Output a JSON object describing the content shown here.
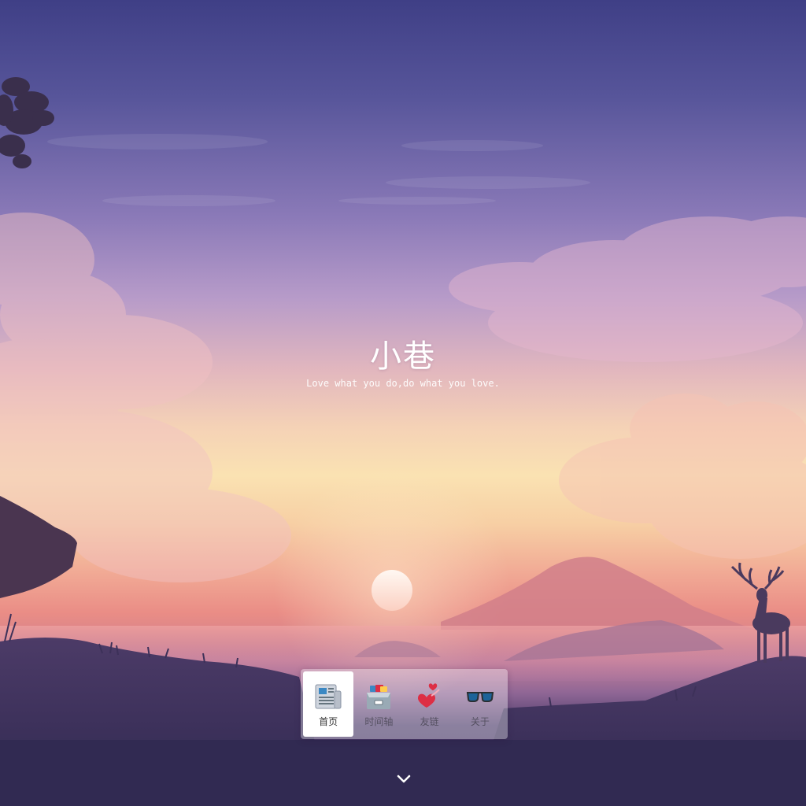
{
  "hero": {
    "title": "小巷",
    "subtitle": "Love what you do,do what you love."
  },
  "nav": {
    "items": [
      {
        "label": "首页",
        "icon": "newspaper-icon",
        "active": true
      },
      {
        "label": "时间轴",
        "icon": "card-file-box-icon",
        "active": false
      },
      {
        "label": "友链",
        "icon": "two-hearts-icon",
        "active": false
      },
      {
        "label": "关于",
        "icon": "sunglasses-icon",
        "active": false
      }
    ]
  },
  "scroll_indicator": {
    "icon": "chevron-down-icon"
  },
  "colors": {
    "sky_top": "#3f3f86",
    "horizon_glow": "#fae2b2",
    "sunset_pink": "#ea8d86",
    "ground": "#342c55",
    "silhouette": "#4a3a5e",
    "nav_active_bg": "#ffffff",
    "heart_red": "#e0263a"
  }
}
